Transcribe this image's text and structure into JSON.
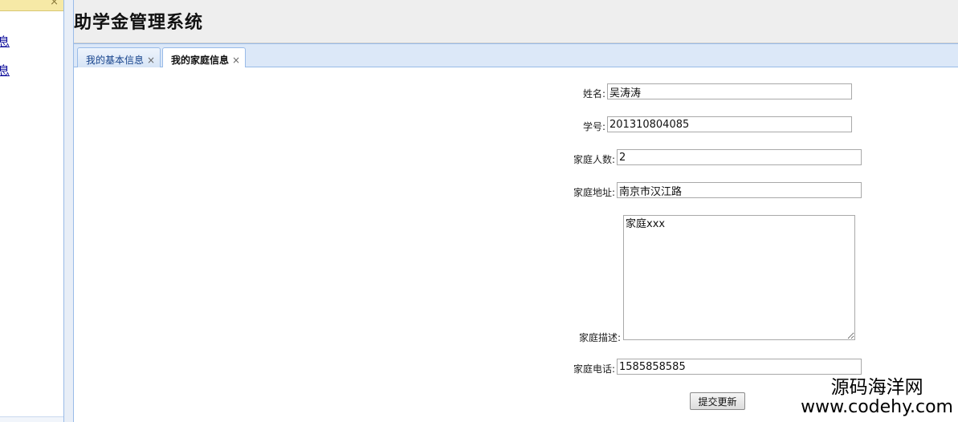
{
  "sidebar": {
    "close_icon": "×",
    "items": [
      {
        "label": "息"
      },
      {
        "label": "息"
      }
    ]
  },
  "header": {
    "title": "助学金管理系统"
  },
  "tabs": [
    {
      "label": "我的基本信息",
      "close": "×"
    },
    {
      "label": "我的家庭信息",
      "close": "×",
      "active": true
    }
  ],
  "form": {
    "name_label": "姓名:",
    "name_value": "吴涛涛",
    "student_id_label": "学号:",
    "student_id_value": "201310804085",
    "family_size_label": "家庭人数:",
    "family_size_value": "2",
    "address_label": "家庭地址:",
    "address_value": "南京市汉江路",
    "description_label": "家庭描述:",
    "description_value": "家庭xxx",
    "phone_label": "家庭电话:",
    "phone_value": "1585858585",
    "submit_label": "提交更新"
  },
  "watermark": {
    "line1": "源码海洋网",
    "line2": "www.codehy.com"
  }
}
